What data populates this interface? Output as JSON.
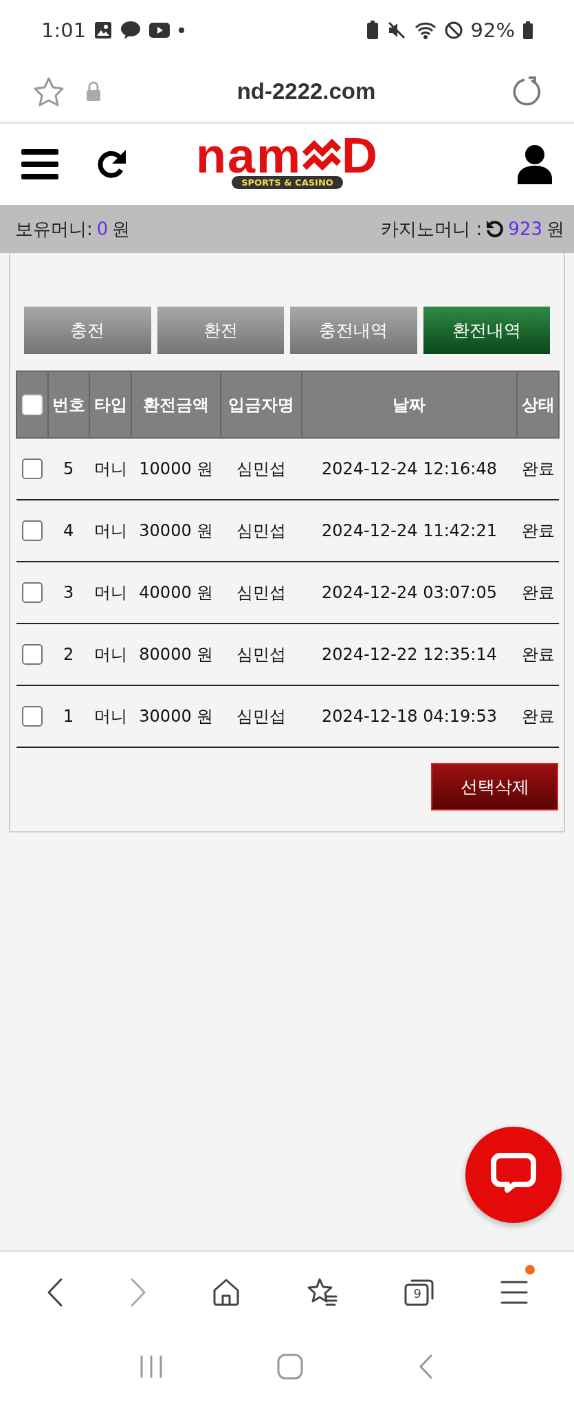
{
  "status_bar": {
    "time": "1:01",
    "battery": "92%"
  },
  "browser": {
    "url": "nd-2222.com",
    "tab_count": "9"
  },
  "logo": {
    "left": "nam",
    "right": "D",
    "tagline": "SPORTS & CASINO"
  },
  "balance": {
    "held_label": "보유머니:",
    "held_value": "0",
    "held_unit": "원",
    "casino_label": "카지노머니 :",
    "casino_value": "923",
    "casino_unit": "원"
  },
  "tabs": [
    {
      "label": "충전",
      "selected": false
    },
    {
      "label": "환전",
      "selected": false
    },
    {
      "label": "충전내역",
      "selected": false
    },
    {
      "label": "환전내역",
      "selected": true
    }
  ],
  "table": {
    "select_all": false,
    "columns": [
      "번호",
      "타입",
      "환전금액",
      "입금자명",
      "날짜",
      "상태"
    ],
    "rows": [
      {
        "checked": false,
        "cells": [
          "5",
          "머니",
          "10000 원",
          "심민섭",
          "2024-12-24 12:16:48",
          "완료"
        ]
      },
      {
        "checked": false,
        "cells": [
          "4",
          "머니",
          "30000 원",
          "심민섭",
          "2024-12-24 11:42:21",
          "완료"
        ]
      },
      {
        "checked": false,
        "cells": [
          "3",
          "머니",
          "40000 원",
          "심민섭",
          "2024-12-24 03:07:05",
          "완료"
        ]
      },
      {
        "checked": false,
        "cells": [
          "2",
          "머니",
          "80000 원",
          "심민섭",
          "2024-12-22 12:35:14",
          "완료"
        ]
      },
      {
        "checked": false,
        "cells": [
          "1",
          "머니",
          "30000 원",
          "심민섭",
          "2024-12-18 04:19:53",
          "완료"
        ]
      }
    ]
  },
  "delete_button": "선택삭제"
}
